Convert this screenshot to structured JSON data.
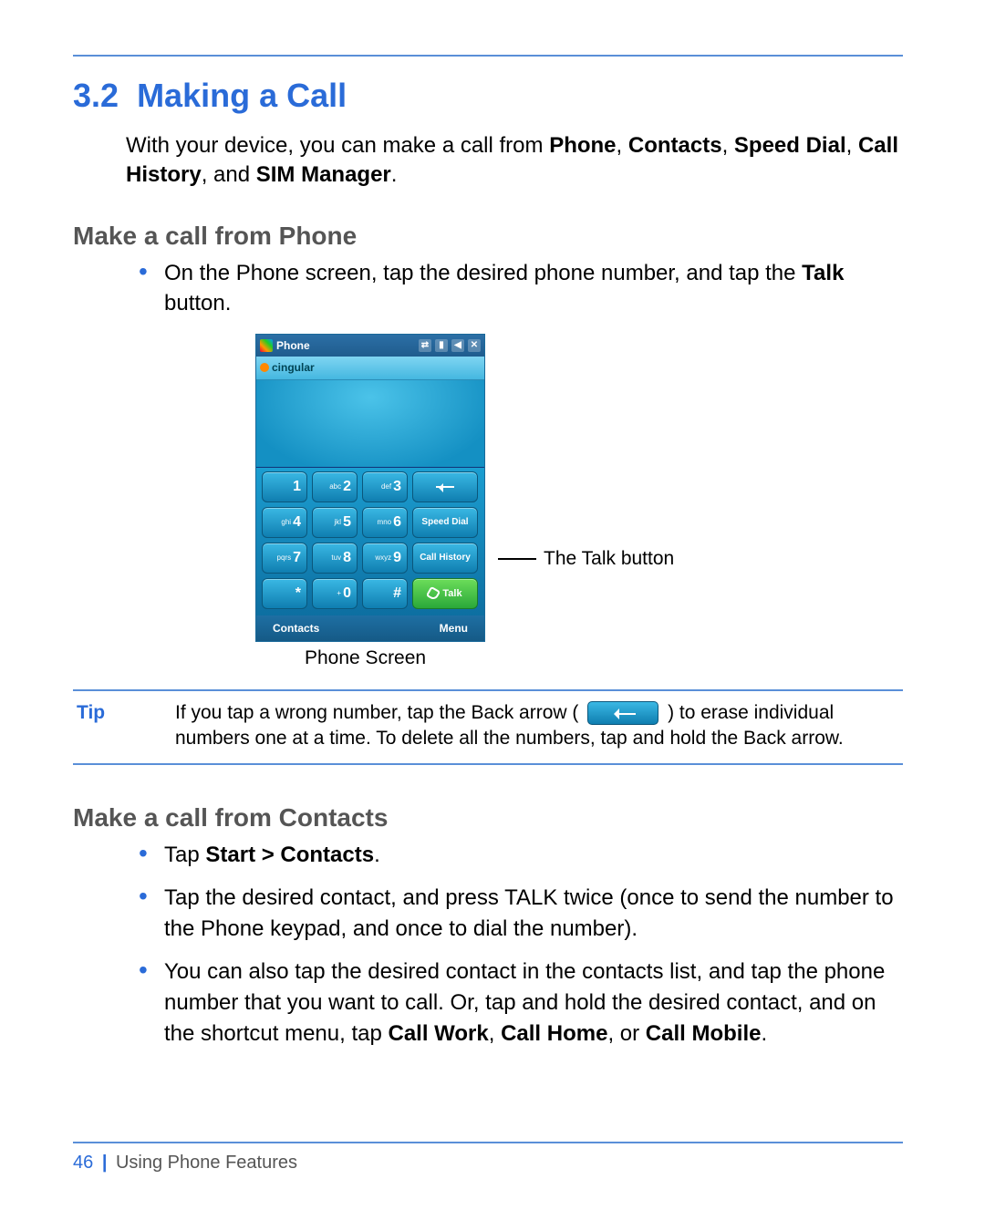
{
  "section_number": "3.2",
  "section_title": "Making a Call",
  "intro_parts": {
    "p1": "With your device, you can make a call from ",
    "b1": "Phone",
    "c1": ", ",
    "b2": "Contacts",
    "c2": ", ",
    "b3": "Speed Dial",
    "c3": ", ",
    "b4": "Call History",
    "c4": ", and ",
    "b5": "SIM Manager",
    "c5": "."
  },
  "sub1_title": "Make a call from Phone",
  "sub1_bullets": [
    {
      "p1": "On the Phone screen, tap the desired phone number, and tap the ",
      "b1": "Talk",
      "p2": " button."
    }
  ],
  "phone": {
    "titlebar": "Phone",
    "status_icons": {
      "sync": "⇄",
      "signal": "▮",
      "volume": "◀",
      "close": "✕"
    },
    "carrier": "cingular",
    "keys": {
      "r1": [
        {
          "pre": "",
          "big": "1"
        },
        {
          "pre": "abc",
          "big": "2"
        },
        {
          "pre": "def",
          "big": "3"
        }
      ],
      "r2": [
        {
          "pre": "ghi",
          "big": "4"
        },
        {
          "pre": "jkl",
          "big": "5"
        },
        {
          "pre": "mno",
          "big": "6"
        }
      ],
      "r3": [
        {
          "pre": "pqrs",
          "big": "7"
        },
        {
          "pre": "tuv",
          "big": "8"
        },
        {
          "pre": "wxyz",
          "big": "9"
        }
      ],
      "r4": [
        {
          "pre": "",
          "big": "*"
        },
        {
          "pre": "+",
          "big": "0"
        },
        {
          "pre": "",
          "big": "#"
        }
      ],
      "speed_dial": "Speed Dial",
      "call_history": "Call History",
      "talk": "Talk"
    },
    "bottom_left": "Contacts",
    "bottom_right": "Menu"
  },
  "callout_talk": "The Talk button",
  "phone_caption": "Phone Screen",
  "tip_label": "Tip",
  "tip_body": {
    "p1": "If you tap a wrong number, tap the Back arrow ( ",
    "p2": " ) to erase individual numbers one at a time. To delete all the numbers, tap and hold the Back arrow."
  },
  "sub2_title": "Make a call from Contacts",
  "sub2_bullets": [
    {
      "p1": "Tap ",
      "b1": "Start > Contacts",
      "p2": "."
    },
    {
      "p1": "Tap the desired contact, and press TALK twice (once to send the number to the Phone keypad, and once to dial the number)."
    },
    {
      "p1": "You can also tap the desired contact in the contacts list, and tap the phone number that you want to call. Or, tap and hold the desired contact, and on the shortcut menu, tap ",
      "b1": "Call Work",
      "p2": ", ",
      "b2": "Call Home",
      "p3": ", or ",
      "b3": "Call Mobile",
      "p4": "."
    }
  ],
  "footer": {
    "page": "46",
    "chapter": "Using Phone Features"
  }
}
